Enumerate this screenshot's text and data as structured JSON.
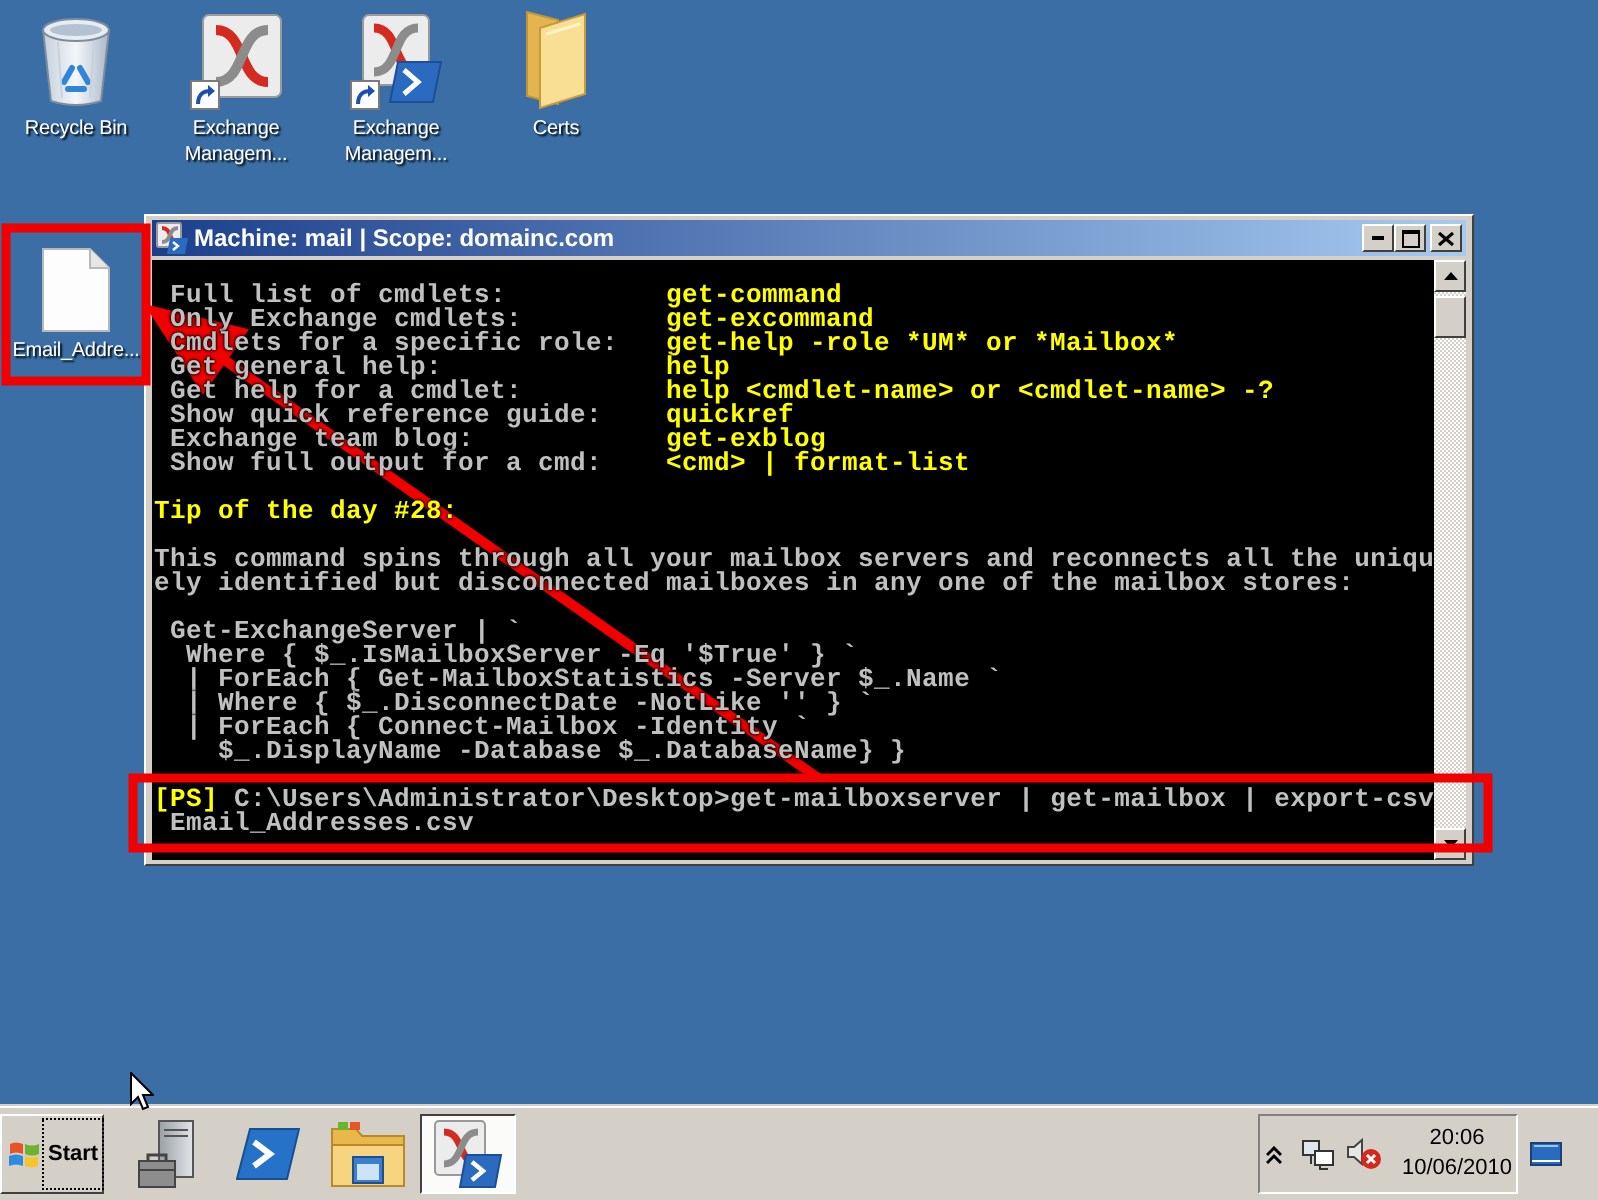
{
  "desktop": {
    "icons": [
      {
        "kind": "recycle-bin",
        "label": "Recycle Bin"
      },
      {
        "kind": "exchange-console",
        "label": "Exchange Managem..."
      },
      {
        "kind": "exchange-shell",
        "label": "Exchange Managem..."
      },
      {
        "kind": "folder",
        "label": "Certs"
      },
      {
        "kind": "document",
        "label": "Email_Addre..."
      }
    ]
  },
  "window": {
    "title": "Machine: mail | Scope: domainc.com"
  },
  "console": {
    "help_rows": [
      {
        "label": "Full list of cmdlets:",
        "command": "get-command"
      },
      {
        "label": "Only Exchange cmdlets:",
        "command": "get-excommand"
      },
      {
        "label": "Cmdlets for a specific role:",
        "command": "get-help -role *UM* or *Mailbox*"
      },
      {
        "label": "Get general help:",
        "command": "help"
      },
      {
        "label": "Get help for a cmdlet:",
        "command": "help <cmdlet-name> or <cmdlet-name> -?"
      },
      {
        "label": "Show quick reference guide:",
        "command": "quickref"
      },
      {
        "label": "Exchange team blog:",
        "command": "get-exblog"
      },
      {
        "label": "Show full output for a cmd:",
        "command": "<cmd> | format-list"
      }
    ],
    "tip_title": "Tip of the day #28:",
    "tip_lines": [
      "This command spins through all your mailbox servers and reconnects all the uniqu",
      "ely identified but disconnected mailboxes in any one of the mailbox stores:"
    ],
    "code_lines": [
      " Get-ExchangeServer | `",
      "  Where { $_.IsMailboxServer -Eq '$True' } `",
      "  | ForEach { Get-MailboxStatistics -Server $_.Name `",
      "  | Where { $_.DisconnectDate -NotLike '' } `",
      "  | ForEach { Connect-Mailbox -Identity `",
      "    $_.DisplayName -Database $_.DatabaseName} }"
    ],
    "session_lines": [
      {
        "prompt": "[PS]",
        "text": " C:\\Users\\Administrator\\Desktop>get-mailboxserver | get-mailbox | export-csv"
      },
      {
        "text": " Email_Addresses.csv"
      }
    ]
  },
  "taskbar": {
    "start": "Start",
    "apps": [
      {
        "kind": "server-manager",
        "selected": false
      },
      {
        "kind": "powershell",
        "selected": false
      },
      {
        "kind": "explorer",
        "selected": false
      },
      {
        "kind": "exchange-shell",
        "selected": true
      }
    ],
    "clock": {
      "time": "20:06",
      "date": "10/06/2010"
    }
  }
}
